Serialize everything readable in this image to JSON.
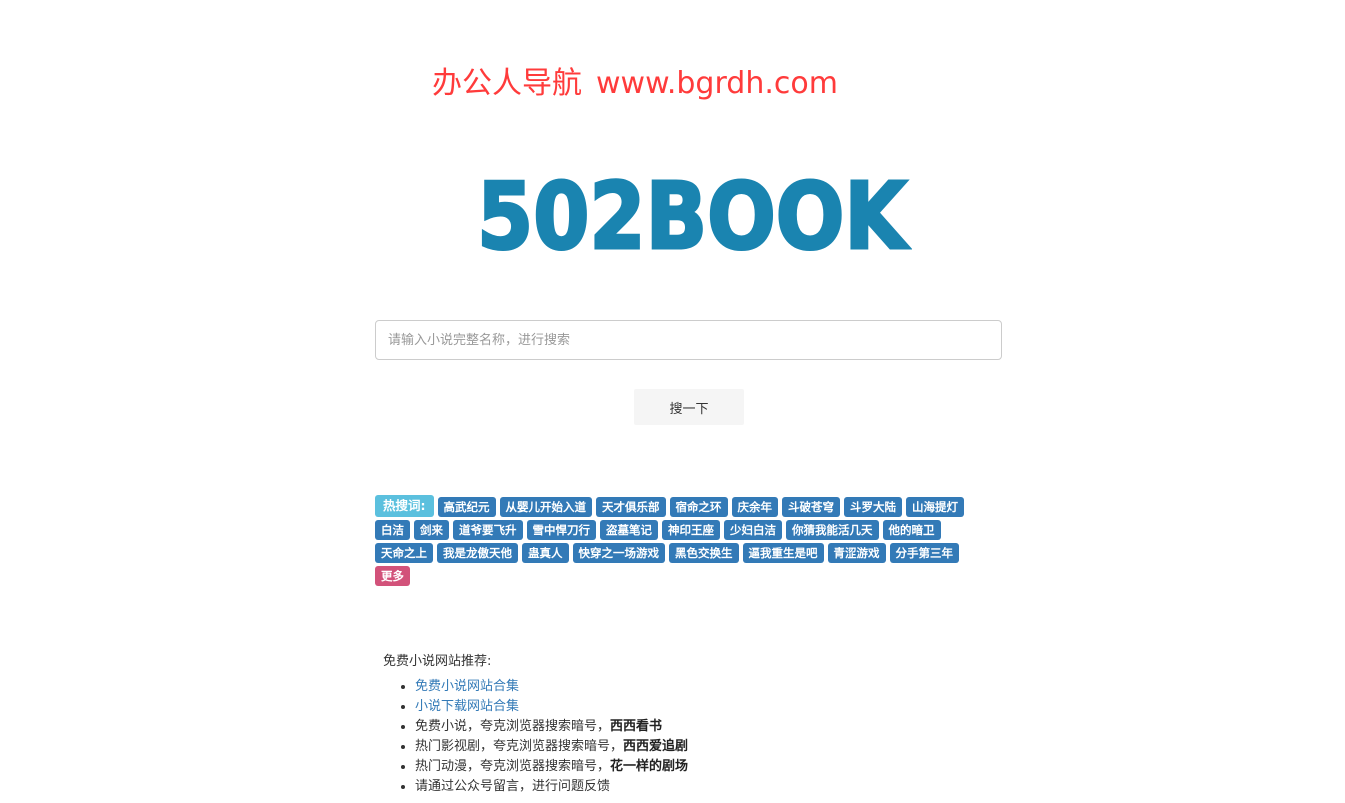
{
  "banner": {
    "name": "办公人导航",
    "url": "www.bgrdh.com"
  },
  "logo": {
    "text": "502BOOK",
    "color": "#1a84b0"
  },
  "search": {
    "placeholder": "请输入小说完整名称，进行搜索",
    "value": "",
    "button_label": "搜一下"
  },
  "hot": {
    "label": "热搜词:",
    "tags": [
      "高武纪元",
      "从婴儿开始入道",
      "天才俱乐部",
      "宿命之环",
      "庆余年",
      "斗破苍穹",
      "斗罗大陆",
      "山海提灯",
      "白洁",
      "剑来",
      "道爷要飞升",
      "雪中悍刀行",
      "盗墓笔记",
      "神印王座",
      "少妇白洁",
      "你猜我能活几天",
      "他的暗卫",
      "天命之上",
      "我是龙傲天他",
      "蛊真人",
      "快穿之一场游戏",
      "黑色交换生",
      "逼我重生是吧",
      "青涩游戏",
      "分手第三年"
    ],
    "more_label": "更多"
  },
  "recommend": {
    "title": "免费小说网站推荐:",
    "items": [
      {
        "link": "免费小说网站合集"
      },
      {
        "link": "小说下载网站合集"
      },
      {
        "text": "免费小说，夸克浏览器搜索暗号，",
        "bold": "西西看书"
      },
      {
        "text": "热门影视剧，夸克浏览器搜索暗号，",
        "bold": "西西爱追剧"
      },
      {
        "text": "热门动漫，夸克浏览器搜索暗号，",
        "bold": "花一样的剧场"
      },
      {
        "text": "请通过公众号留言，进行问题反馈"
      }
    ]
  },
  "colors": {
    "banner_red": "#ff3b3b",
    "tag_blue": "#337ab7",
    "label_cyan": "#5bc0de",
    "more_pink": "#d2527a",
    "link_blue": "#337ab7"
  }
}
